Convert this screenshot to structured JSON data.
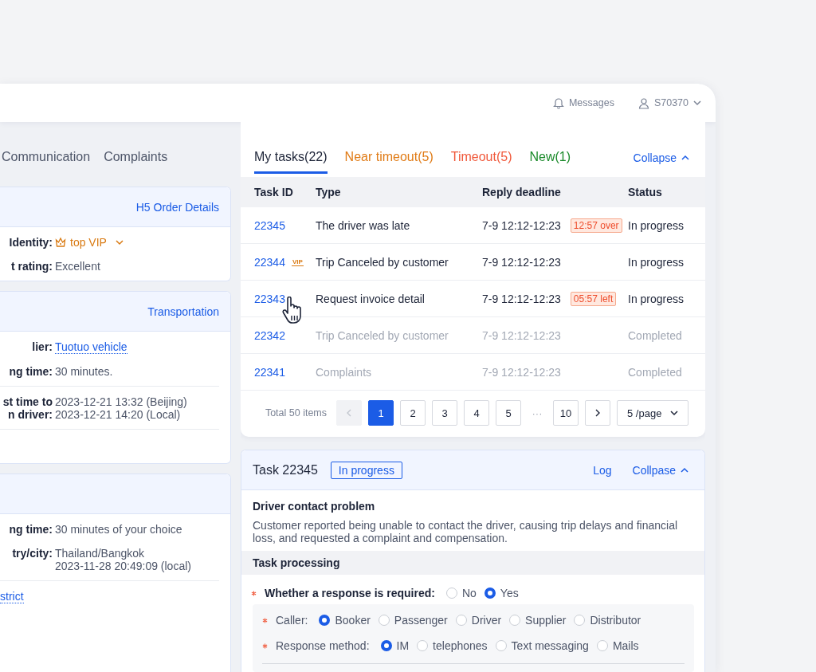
{
  "header": {
    "messages": "Messages",
    "user": "S70370"
  },
  "left_tabs": [
    {
      "label": "Communication"
    },
    {
      "label": "Complaints"
    }
  ],
  "left_cards": [
    {
      "link": "H5 Order Details",
      "groups": [
        [
          {
            "label": [
              "Identity:"
            ],
            "value": [
              "top VIP"
            ],
            "kind": "vip"
          },
          {
            "label": [
              "t rating:"
            ],
            "value": [
              "Excellent"
            ],
            "kind": "text"
          }
        ]
      ]
    },
    {
      "link": "Transportation",
      "groups": [
        [
          {
            "label": [
              "lier:"
            ],
            "value": [
              "Tuotuo vehicle"
            ],
            "kind": "link"
          },
          {
            "label": [
              "ng time:"
            ],
            "value": [
              "30 minutes."
            ],
            "kind": "text"
          }
        ],
        [
          {
            "label": [
              "st time to",
              "n driver:"
            ],
            "value": [
              "2023-12-21 13:32 (Beijing)",
              "2023-12-21 14:20 (Local)"
            ],
            "kind": "text"
          }
        ]
      ]
    },
    {
      "groups": [
        [
          {
            "label": [
              "ng time:"
            ],
            "value": [
              "30 minutes of your choice"
            ],
            "kind": "text"
          },
          {
            "label": [
              "try/city:"
            ],
            "value": [
              "Thailand/Bangkok",
              "2023-11-28 20:49:09 (local)"
            ],
            "kind": "text"
          }
        ],
        [
          {
            "value": [
              "strict"
            ],
            "kind": "bare-link"
          }
        ]
      ]
    }
  ],
  "tasks": {
    "tabs": [
      {
        "label": "My tasks(22)",
        "selected": true,
        "color": "#1d2438"
      },
      {
        "label": "Near timeout(5)",
        "selected": false,
        "color": "#e07b16"
      },
      {
        "label": "Timeout(5)",
        "selected": false,
        "color": "#f0583a"
      },
      {
        "label": "New(1)",
        "selected": false,
        "color": "#1a8a2a"
      }
    ],
    "collapse": "Collapse",
    "columns": [
      "Task ID",
      "Type",
      "Reply deadline",
      "Status"
    ],
    "rows": [
      {
        "id": "22345",
        "type": "The driver was late",
        "deadline": "7-9 12:12-12:23",
        "tag": "12:57 over",
        "status": "In progress",
        "done": false
      },
      {
        "id": "22344",
        "badge": "VIP",
        "type": "Trip Canceled by customer",
        "deadline": "7-9 12:12-12:23",
        "status": "In progress",
        "done": false
      },
      {
        "id": "22343",
        "type": "Request invoice detail",
        "deadline": "7-9 12:12-12:23",
        "tag": "05:57 left",
        "status": "In progress",
        "done": false
      },
      {
        "id": "22342",
        "type": "Trip Canceled by customer",
        "deadline": "7-9 12:12-12:23",
        "status": "Completed",
        "done": true
      },
      {
        "id": "22341",
        "type": "Complaints",
        "deadline": "7-9 12:12-12:23",
        "status": "Completed",
        "done": true
      }
    ],
    "pagination": {
      "total": "Total 50 items",
      "prev_disabled": true,
      "next_disabled": false,
      "pages": [
        {
          "label": "1",
          "kind": "page",
          "selected": true
        },
        {
          "label": "2",
          "kind": "page",
          "selected": false
        },
        {
          "label": "3",
          "kind": "page",
          "selected": false
        },
        {
          "label": "4",
          "kind": "page",
          "selected": false
        },
        {
          "label": "5",
          "kind": "page",
          "selected": false
        },
        {
          "label": "···",
          "kind": "ellipsis"
        },
        {
          "label": "10",
          "kind": "page",
          "selected": false
        }
      ],
      "page_size": "5 /page"
    }
  },
  "task": {
    "title": "Task 22345",
    "status": "In progress",
    "log": "Log",
    "collapse": "Collpase",
    "heading": "Driver contact problem",
    "description": "Customer reported being unable to contact the driver, causing trip delays and financial loss, and requested a complaint and compensation.",
    "section": "Task processing",
    "question": {
      "label": "Whether a response is required:",
      "required": true,
      "options": [
        {
          "label": "No",
          "selected": false
        },
        {
          "label": "Yes",
          "selected": true
        }
      ]
    },
    "sub_questions": [
      {
        "label": "Caller:",
        "required": true,
        "options": [
          {
            "label": "Booker",
            "selected": true
          },
          {
            "label": "Passenger",
            "selected": false
          },
          {
            "label": "Driver",
            "selected": false
          },
          {
            "label": "Supplier",
            "selected": false
          },
          {
            "label": "Distributor",
            "selected": false
          }
        ]
      },
      {
        "label": "Response method:",
        "required": true,
        "options": [
          {
            "label": "IM",
            "selected": true
          },
          {
            "label": "telephones",
            "selected": false
          },
          {
            "label": "Text messaging",
            "selected": false
          },
          {
            "label": "Mails",
            "selected": false
          }
        ]
      }
    ]
  }
}
